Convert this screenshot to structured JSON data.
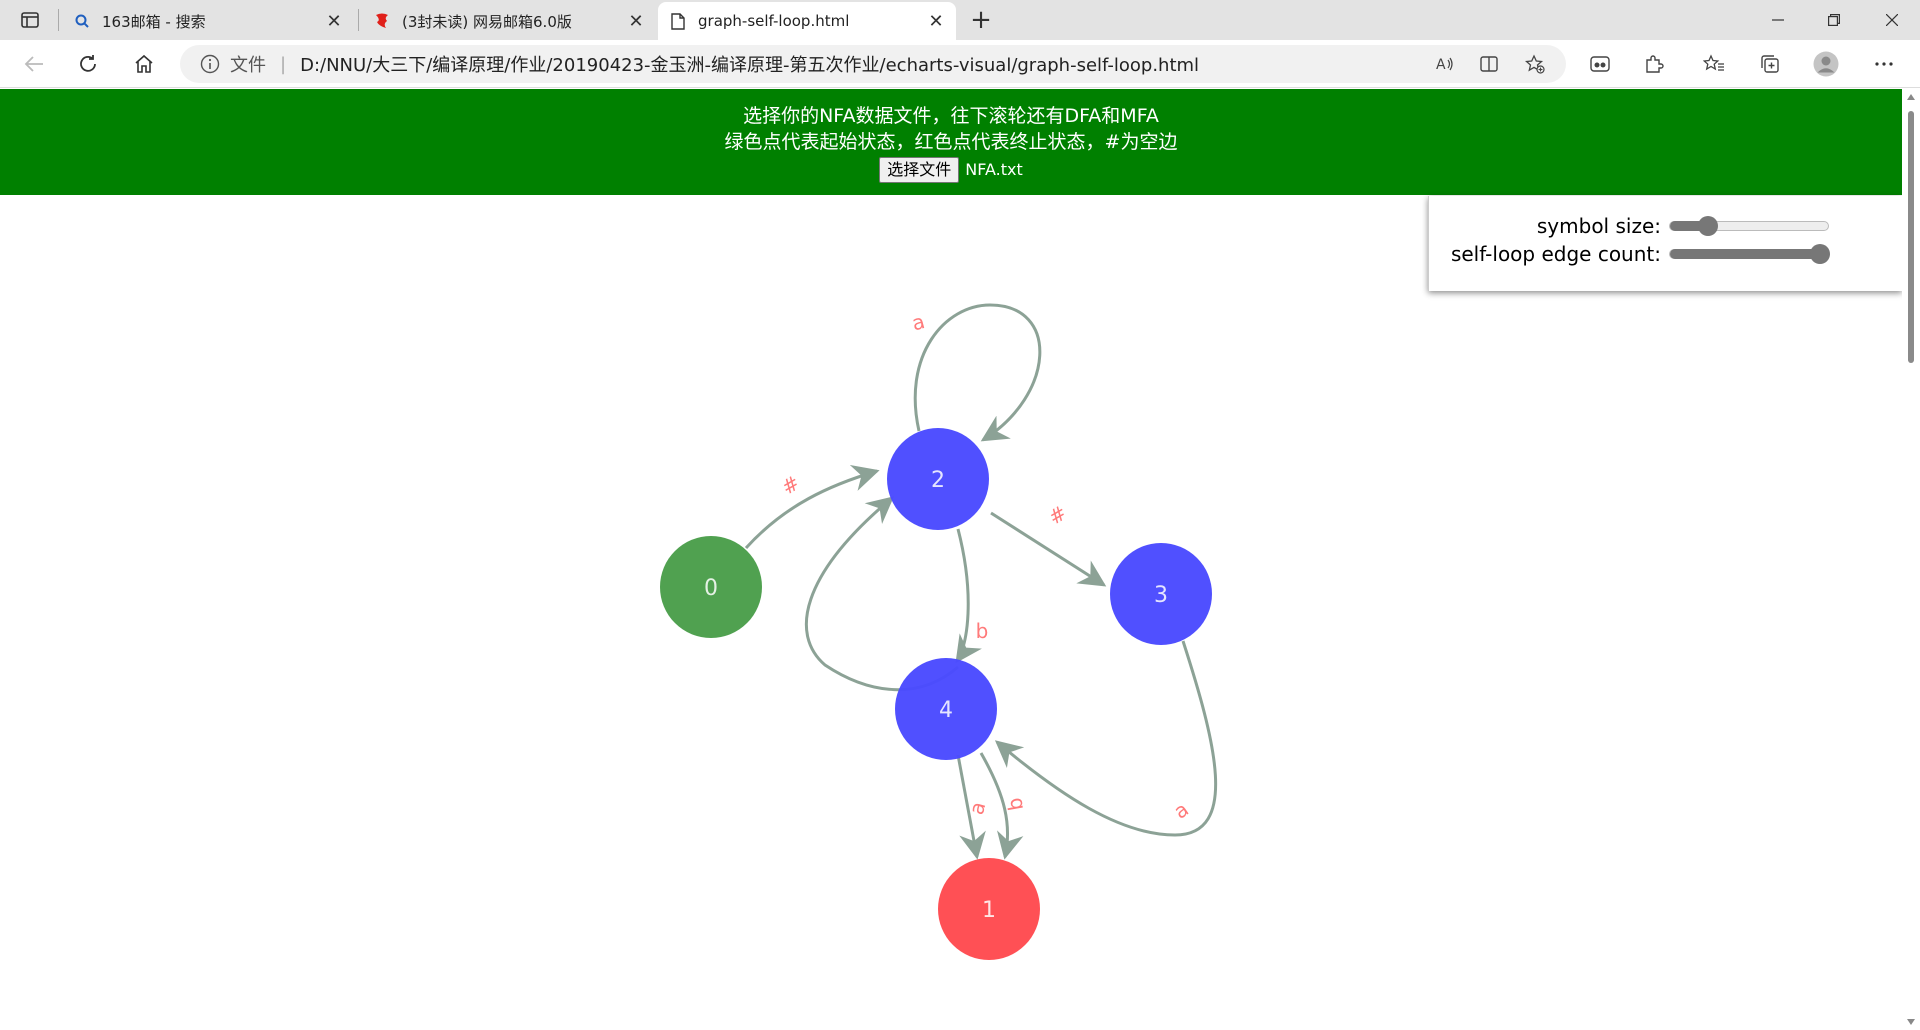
{
  "browser": {
    "tabs": [
      {
        "title": "163邮箱 - 搜索",
        "icon": "search-icon"
      },
      {
        "title": "(3封未读) 网易邮箱6.0版",
        "icon": "netease-mail-icon"
      },
      {
        "title": "graph-self-loop.html",
        "icon": "file-icon",
        "active": true
      }
    ],
    "address": {
      "scheme_label": "文件",
      "url": "D:/NNU/大三下/编译原理/作业/20190423-金玉洲-编译原理-第五次作业/echarts-visual/graph-self-loop.html"
    }
  },
  "page": {
    "banner": {
      "line1": "选择你的NFA数据文件，往下滚轮还有DFA和MFA",
      "line2": "绿色点代表起始状态，红色点代表终止状态，#为空边",
      "file_button": "选择文件",
      "file_name": "NFA.txt",
      "bg_color": "#008000"
    },
    "controls": {
      "symbol_size_label": "symbol size:",
      "symbol_size_fraction": 0.2,
      "self_loop_label": "self-loop edge count:",
      "self_loop_fraction": 1.0
    }
  },
  "graph": {
    "colors": {
      "start": "#4a9e4a",
      "end": "#ff4a4f",
      "normal": "#4a4aff",
      "edge": "#8ca296",
      "edge_label": "#ff7a7a"
    },
    "nodes": [
      {
        "id": "0",
        "label": "0",
        "kind": "start"
      },
      {
        "id": "2",
        "label": "2",
        "kind": "normal"
      },
      {
        "id": "3",
        "label": "3",
        "kind": "normal"
      },
      {
        "id": "4",
        "label": "4",
        "kind": "normal"
      },
      {
        "id": "1",
        "label": "1",
        "kind": "end"
      }
    ],
    "edges": [
      {
        "source": "2",
        "target": "2",
        "label": "a"
      },
      {
        "source": "0",
        "target": "2",
        "label": "#"
      },
      {
        "source": "2",
        "target": "3",
        "label": "#"
      },
      {
        "source": "2",
        "target": "4",
        "label": "b"
      },
      {
        "source": "4",
        "target": "2",
        "label": ""
      },
      {
        "source": "4",
        "target": "1",
        "label": "a"
      },
      {
        "source": "4",
        "target": "1",
        "label": "b"
      },
      {
        "source": "3",
        "target": "4",
        "label": "a"
      }
    ]
  }
}
